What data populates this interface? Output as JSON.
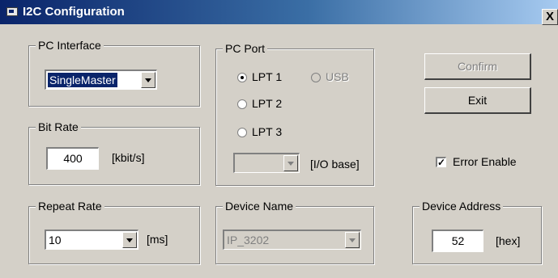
{
  "window": {
    "title": "I2C Configuration",
    "close_label": "X"
  },
  "pc_interface": {
    "legend": "PC Interface",
    "selected": "SingleMaster"
  },
  "bit_rate": {
    "legend": "Bit Rate",
    "value": "400",
    "unit": "[kbit/s]"
  },
  "repeat_rate": {
    "legend": "Repeat Rate",
    "selected": "10",
    "unit": "[ms]"
  },
  "pc_port": {
    "legend": "PC Port",
    "options": [
      {
        "label": "LPT 1",
        "checked": true,
        "enabled": true
      },
      {
        "label": "USB",
        "checked": false,
        "enabled": false
      },
      {
        "label": "LPT 2",
        "checked": false,
        "enabled": true
      },
      {
        "label": "LPT 3",
        "checked": false,
        "enabled": true
      }
    ],
    "io_base_value": "",
    "io_base_unit": "[I/O base]"
  },
  "device_name": {
    "legend": "Device Name",
    "selected": "IP_3202"
  },
  "buttons": {
    "confirm": "Confirm",
    "exit": "Exit"
  },
  "error_enable": {
    "label": "Error Enable",
    "checked": true,
    "mark": "✓"
  },
  "device_address": {
    "legend": "Device Address",
    "value": "52",
    "unit": "[hex]"
  }
}
